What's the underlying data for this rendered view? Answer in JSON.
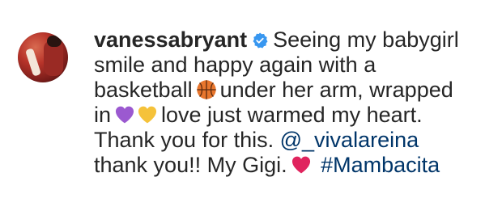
{
  "comment": {
    "username": "vanessabryant",
    "avatar_icon": "profile-photo",
    "verified_icon": "verified-badge-icon",
    "colors": {
      "text": "#262626",
      "link": "#003569",
      "verified": "#3897f0",
      "heart_red": "#e0245e",
      "heart_purple": "#9b59d0",
      "heart_yellow": "#f5c23a",
      "basketball": "#e8762d"
    },
    "segments": {
      "line1_rest": "Seeing my babygirl",
      "line2": "smile and happy again with a",
      "line3_a": "basketball",
      "line3_b": "under her arm, wrapped",
      "line4_a": "in",
      "line4_b": "love just warmed my heart.",
      "line5_a": "Thank you for this.",
      "mention": "@_vivalareina",
      "line6_a": "thank you!! My Gigi.",
      "hashtag": "#Mambacita"
    },
    "emojis": [
      "basketball-emoji",
      "purple-heart-emoji",
      "yellow-heart-emoji",
      "red-heart-emoji"
    ]
  }
}
